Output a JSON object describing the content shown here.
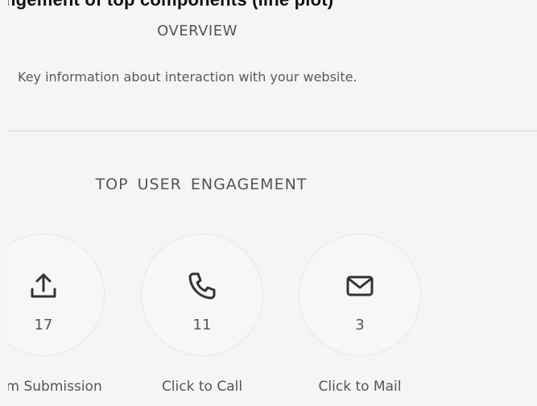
{
  "header_fragment": "ngement of top components (line plot)",
  "overview": {
    "title": "OVERVIEW",
    "subtitle": "Key information about interaction with your website."
  },
  "engagement": {
    "title": "TOP USER ENGAGEMENT",
    "items": [
      {
        "icon": "upload-icon",
        "count": "17",
        "label": "Form Submission"
      },
      {
        "icon": "phone-icon",
        "count": "11",
        "label": "Click to Call"
      },
      {
        "icon": "mail-icon",
        "count": "3",
        "label": "Click to Mail"
      }
    ]
  },
  "colors": {
    "background": "#f5f5f5",
    "text": "#555555",
    "divider": "#d2d2d2",
    "circle_fill": "#f7f7f7",
    "icon": "#333333"
  }
}
